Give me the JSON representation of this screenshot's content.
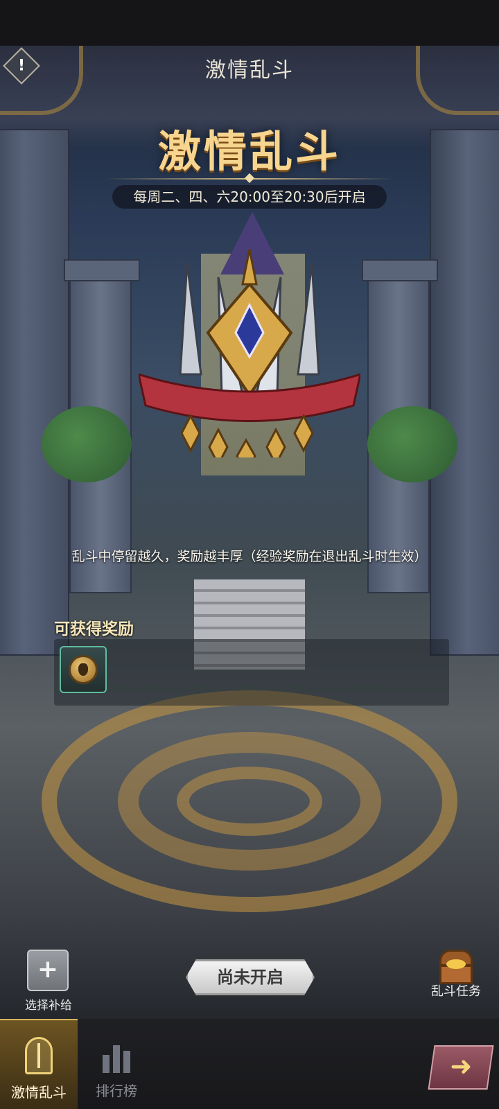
{
  "header": {
    "title": "激情乱斗",
    "info_icon": "exclamation-icon"
  },
  "banner": {
    "title": "激情乱斗",
    "schedule": "每周二、四、六20:00至20:30后开启"
  },
  "hint": "乱斗中停留越久，奖励越丰厚（经验奖励在退出乱斗时生效）",
  "rewards": {
    "label": "可获得奖励",
    "items": [
      {
        "icon": "skull-coin-icon"
      }
    ]
  },
  "actions": {
    "supply_label": "选择补给",
    "supply_icon": "plus-icon",
    "status_button": "尚未开启",
    "task_label": "乱斗任务",
    "task_icon": "treasure-chest-icon"
  },
  "tabs": [
    {
      "label": "激情乱斗",
      "active": true,
      "icon": "brawl-crest-icon"
    },
    {
      "label": "排行榜",
      "active": false,
      "icon": "ranking-icon"
    }
  ],
  "next_icon": "arrow-right-icon",
  "colors": {
    "title_gold": "#f7d58f",
    "reward_border": "#5fbc9e",
    "active_tab": "#6d5422"
  }
}
